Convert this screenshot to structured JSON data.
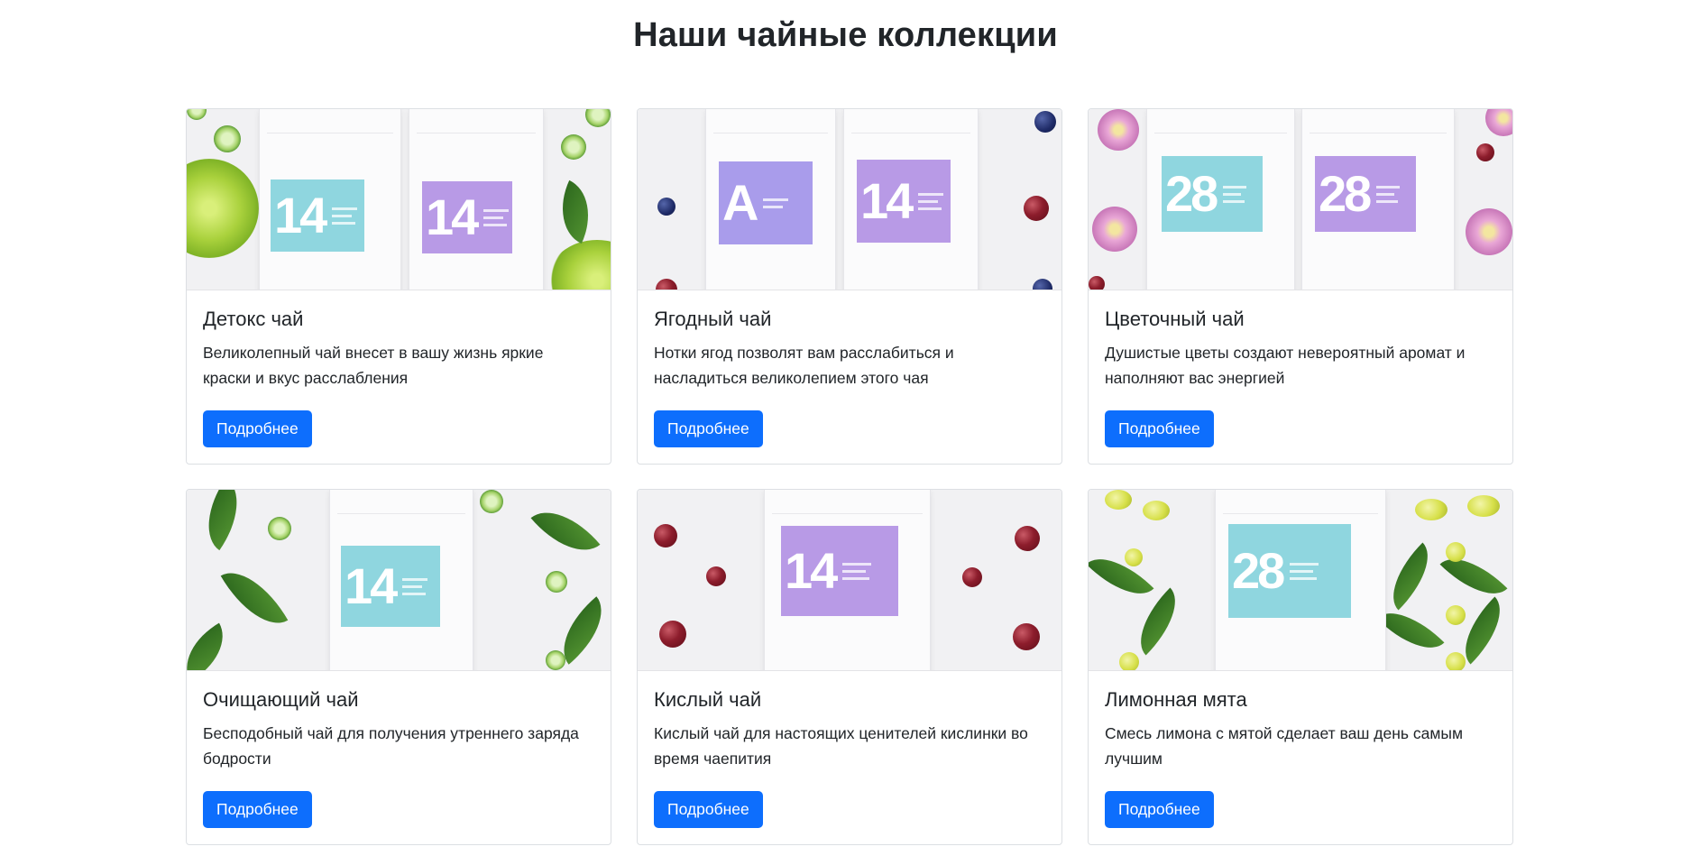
{
  "page": {
    "title": "Наши чайные коллекции"
  },
  "cards": [
    {
      "title": "Детокс чай",
      "text": "Великолепный чай внесет в вашу жизнь яркие краски и вкус расслабления",
      "button": "Подробнее",
      "image_labels": [
        "14",
        "14"
      ]
    },
    {
      "title": "Ягодный чай",
      "text": "Нотки ягод позволят вам расслабиться и насладиться великолепием этого чая",
      "button": "Подробнее",
      "image_labels": [
        "A",
        "14"
      ]
    },
    {
      "title": "Цветочный чай",
      "text": "Душистые цветы создают невероятный аромат и наполняют вас энергией",
      "button": "Подробнее",
      "image_labels": [
        "28",
        "28"
      ]
    },
    {
      "title": "Очищающий чай",
      "text": "Бесподобный чай для получения утреннего заряда бодрости",
      "button": "Подробнее",
      "image_labels": [
        "14"
      ]
    },
    {
      "title": "Кислый чай",
      "text": "Кислый чай для настоящих ценителей кислинки во время чаепития",
      "button": "Подробнее",
      "image_labels": [
        "14"
      ]
    },
    {
      "title": "Лимонная мята",
      "text": "Смесь лимона с мятой сделает ваш день самым лучшим",
      "button": "Подробнее",
      "image_labels": [
        "28"
      ]
    }
  ],
  "colors": {
    "primary_button": "#0d6efd",
    "label_teal": "#8fd6df",
    "label_purple": "#b89ae6"
  }
}
